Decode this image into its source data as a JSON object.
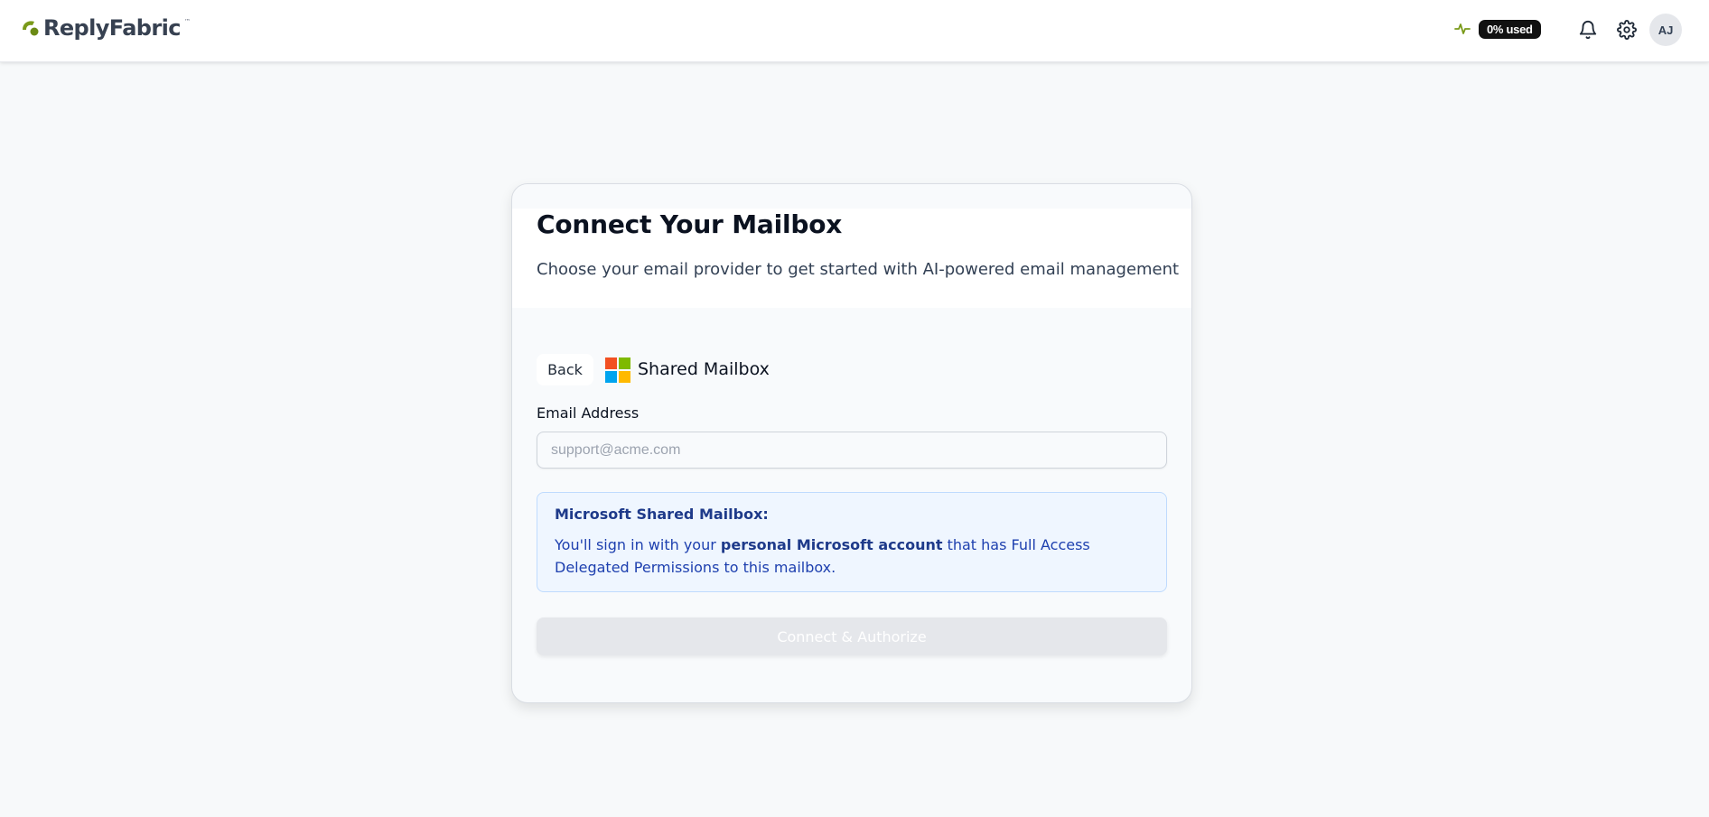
{
  "brand": {
    "name": "ReplyFabric",
    "trademark": "™",
    "accent": "#7a9a1a"
  },
  "header": {
    "usage_label": "0% used",
    "usage_icon": "activity-icon",
    "notifications_icon": "bell-icon",
    "settings_icon": "gear-icon",
    "avatar_initials": "AJ"
  },
  "card": {
    "title": "Connect Your Mailbox",
    "subtitle": "Choose your email provider to get started with AI-powered email management",
    "back_label": "Back",
    "provider_icon": "microsoft-logo-icon",
    "provider_name": "Shared Mailbox",
    "email_label": "Email Address",
    "email_value": "",
    "email_placeholder": "support@acme.com",
    "info": {
      "title": "Microsoft Shared Mailbox:",
      "text_before": "You'll sign in with your ",
      "text_bold": "personal Microsoft account",
      "text_after": " that has Full Access Delegated Permissions to this mailbox."
    },
    "connect_label": "Connect & Authorize",
    "connect_disabled": true
  }
}
